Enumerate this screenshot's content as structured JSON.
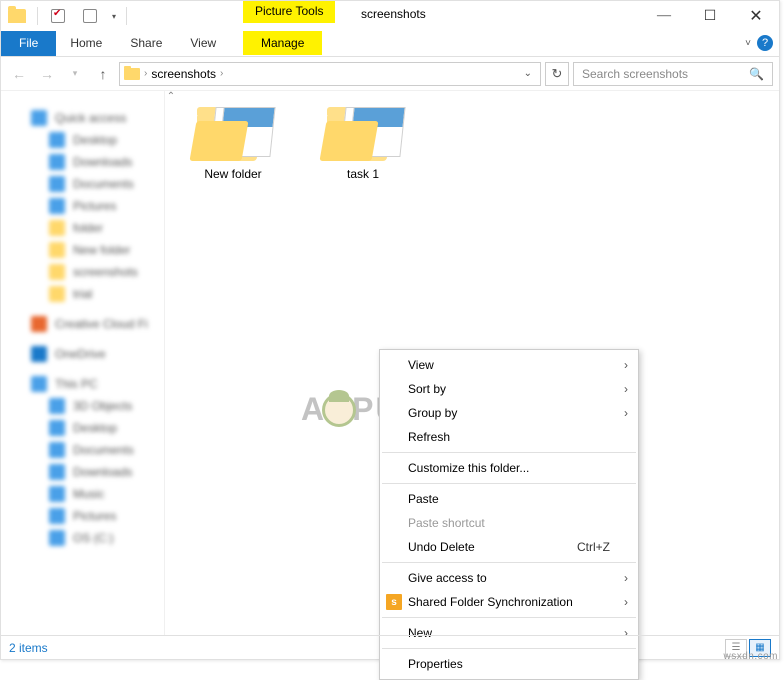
{
  "window": {
    "context_tab_label": "Picture Tools",
    "title": "screenshots",
    "controls": {
      "min": "—",
      "max": "☐",
      "close": "✕"
    }
  },
  "ribbon": {
    "file": "File",
    "home": "Home",
    "share": "Share",
    "view": "View",
    "manage": "Manage"
  },
  "nav": {
    "crumb": "screenshots",
    "crumb_sep": "›",
    "search_placeholder": "Search screenshots"
  },
  "items": [
    {
      "label": "New folder"
    },
    {
      "label": "task 1"
    }
  ],
  "context_menu": {
    "view": "View",
    "sort_by": "Sort by",
    "group_by": "Group by",
    "refresh": "Refresh",
    "customize": "Customize this folder...",
    "paste": "Paste",
    "paste_shortcut": "Paste shortcut",
    "undo_delete": "Undo Delete",
    "undo_shortcut": "Ctrl+Z",
    "give_access": "Give access to",
    "shared_sync": "Shared Folder Synchronization",
    "new": "New",
    "properties": "Properties"
  },
  "statusbar": {
    "count": "2 items"
  },
  "watermark": {
    "pre": "A",
    "post": "PUALS"
  },
  "attribution": "wsxdn.com"
}
